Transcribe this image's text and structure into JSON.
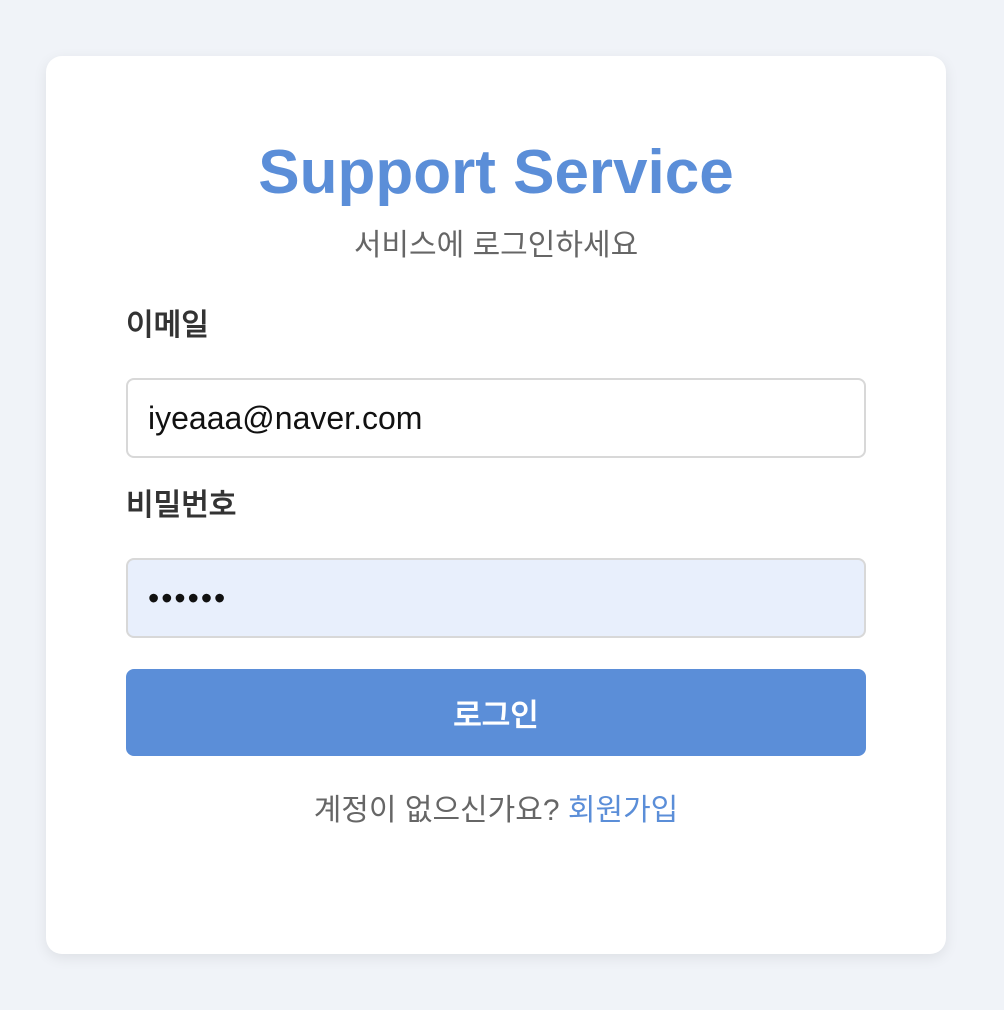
{
  "header": {
    "title": "Support Service",
    "subtitle": "서비스에 로그인하세요"
  },
  "form": {
    "email_label": "이메일",
    "email_value": "iyeaaa@naver.com",
    "password_label": "비밀번호",
    "password_value": "••••••",
    "login_button": "로그인"
  },
  "signup": {
    "prompt": "계정이 없으신가요?",
    "link": "회원가입"
  },
  "colors": {
    "accent": "#5b8ed8",
    "background": "#f0f3f8",
    "card": "#ffffff",
    "password_field_bg": "#e8effc"
  }
}
